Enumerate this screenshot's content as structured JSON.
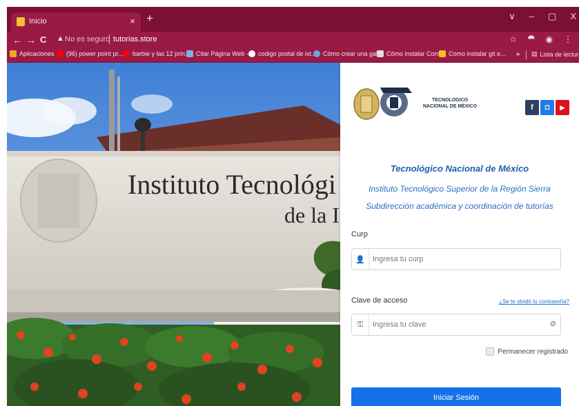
{
  "browser": {
    "tab_title": "Inicio",
    "tab_close": "×",
    "new_tab": "+",
    "window_controls": [
      "∨",
      "–",
      "▢",
      "X"
    ],
    "nav": {
      "back": "←",
      "forward": "→",
      "reload": "C"
    },
    "address": {
      "security_label": "No es seguro",
      "host": "tutorias.store"
    },
    "toolbar_icons": [
      "star-icon",
      "extensions-icon",
      "profile-icon",
      "menu-icon"
    ],
    "bookmarks": [
      {
        "label": "Aplicaciones",
        "icon": "apps-grid-icon",
        "color": "#f6a623"
      },
      {
        "label": "(96) power point pr...",
        "icon": "youtube-icon",
        "color": "#ff0000"
      },
      {
        "label": "barbie y las 12 prin...",
        "icon": "youtube-icon",
        "color": "#ff0000"
      },
      {
        "label": "Citar Página Web -...",
        "icon": "globe-icon",
        "color": "#7fb1e3"
      },
      {
        "label": "codigo postal de ixt...",
        "icon": "google-icon",
        "color": "#ffffff"
      },
      {
        "label": "Cómo crear una gal...",
        "icon": "globe-icon",
        "color": "#6fa6d8"
      },
      {
        "label": "Cómo instalar Com...",
        "icon": "doc-icon",
        "color": "#dddddd"
      },
      {
        "label": "Como instalar git e...",
        "icon": "f-icon",
        "color": "#f5c518"
      }
    ],
    "more_bookmarks": "»",
    "reading_list": "Lista de lectura"
  },
  "hero": {
    "sign_line1": "Instituto Tecnológi",
    "sign_line2": "de la I"
  },
  "panel": {
    "logo_text_line1": "TECNOLOGICO",
    "logo_text_line2": "NACIONAL DE MÉXICO",
    "social": [
      {
        "icon": "facebook-icon",
        "glyph": "f",
        "color": "#2d3f63"
      },
      {
        "icon": "square-icon",
        "glyph": "◘",
        "color": "#1f7be8"
      },
      {
        "icon": "youtube-icon",
        "glyph": "▶",
        "color": "#e0101b"
      }
    ],
    "title": "Tecnológico Nacional de México",
    "subtitle1": "Instituto Tecnológico Superior de la Región Sierra",
    "subtitle2": "Subdirección académica y coordinación de tutorías",
    "curp_label": "Curp",
    "curp_placeholder": "Ingresa tu curp",
    "curp_value": "",
    "password_label": "Clave de acceso",
    "forgot_link": "¿Se te olvidó tu contraseña?",
    "password_placeholder": "Ingresa tu clave",
    "password_value": "",
    "remember_label": "Permanecer registrado",
    "remember_checked": false,
    "login_button": "Iniciar Sesión"
  },
  "colors": {
    "chrome_dark": "#7a1034",
    "chrome": "#9a1a46",
    "brand_blue": "#1f5fb3",
    "button_blue": "#1472e8"
  }
}
